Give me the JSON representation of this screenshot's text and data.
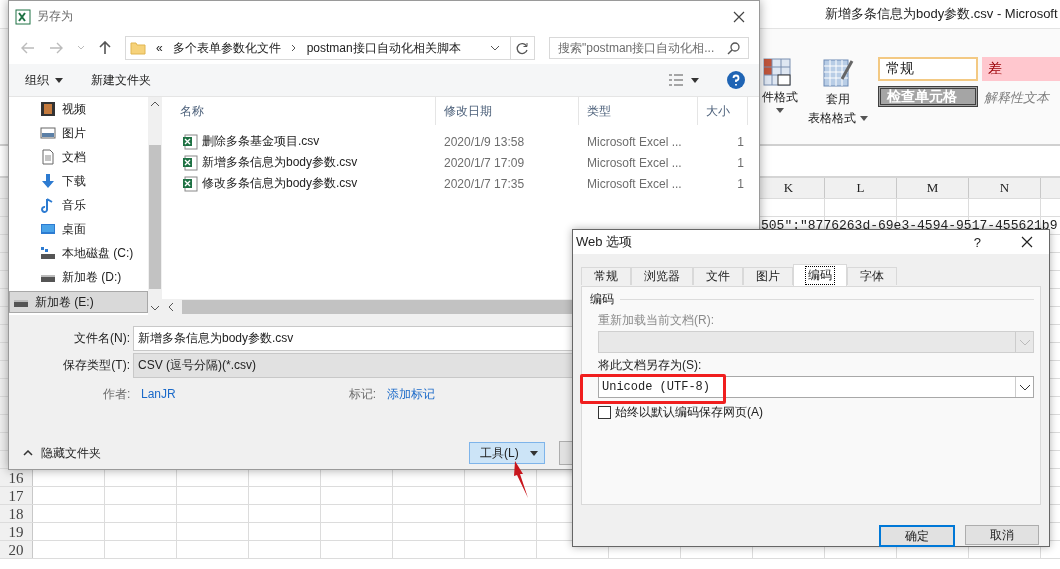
{
  "excel": {
    "title": "新增多条信息为body参数.csv  -  Microsoft",
    "ribbon": {
      "conditional_format": "件格式",
      "table_format_top": "套用",
      "table_format_bottom": "表格格式",
      "styles": [
        {
          "label": "常规",
          "kind": "normal"
        },
        {
          "label": "差",
          "kind": "bad"
        },
        {
          "label": "检查单元格",
          "kind": "check"
        },
        {
          "label": "解释性文本",
          "kind": "explanatory"
        }
      ]
    },
    "columns": [
      "K",
      "L",
      "M",
      "N"
    ],
    "cell_text": "505\":\"8776263d-69e3-4594-9517-455621b9",
    "rows": [
      "16",
      "17",
      "18",
      "19",
      "20"
    ]
  },
  "save_as": {
    "title": "另存为",
    "path": [
      "«",
      "多个表单参数化文件",
      "postman接口自动化相关脚本"
    ],
    "search_placeholder": "搜索\"postman接口自动化相...",
    "organize": "组织",
    "new_folder": "新建文件夹",
    "nav": [
      {
        "label": "视频",
        "kind": "video",
        "selected": false
      },
      {
        "label": "图片",
        "kind": "picture",
        "selected": false
      },
      {
        "label": "文档",
        "kind": "document",
        "selected": false
      },
      {
        "label": "下载",
        "kind": "download",
        "selected": false
      },
      {
        "label": "音乐",
        "kind": "music",
        "selected": false
      },
      {
        "label": "桌面",
        "kind": "desktop",
        "selected": false
      },
      {
        "label": "本地磁盘 (C:)",
        "kind": "system-drive",
        "selected": false
      },
      {
        "label": "新加卷 (D:)",
        "kind": "drive",
        "selected": false
      },
      {
        "label": "新加卷 (E:)",
        "kind": "drive",
        "selected": true
      }
    ],
    "columns": [
      "名称",
      "修改日期",
      "类型",
      "大小"
    ],
    "files": [
      {
        "name": "删除多条基金项目.csv",
        "date": "2020/1/9 13:58",
        "type": "Microsoft Excel ...",
        "size": "1"
      },
      {
        "name": "新增多条信息为body参数.csv",
        "date": "2020/1/7 17:09",
        "type": "Microsoft Excel ...",
        "size": "1"
      },
      {
        "name": "修改多条信息为body参数.csv",
        "date": "2020/1/7 17:35",
        "type": "Microsoft Excel ...",
        "size": "1"
      }
    ],
    "filename_label": "文件名(N):",
    "filename": "新增多条信息为body参数.csv",
    "type_label": "保存类型(T):",
    "type_value": "CSV (逗号分隔)(*.csv)",
    "author_label": "作者:",
    "author": "LanJR",
    "tags_label": "标记:",
    "tags": "添加标记",
    "hide_folders": "隐藏文件夹",
    "tools": "工具(L)"
  },
  "web_options": {
    "title": "Web 选项",
    "help": "?",
    "tabs": [
      {
        "label": "常规",
        "selected": false
      },
      {
        "label": "浏览器",
        "selected": false
      },
      {
        "label": "文件",
        "selected": false
      },
      {
        "label": "图片",
        "selected": false
      },
      {
        "label": "编码",
        "selected": true
      },
      {
        "label": "字体",
        "selected": false
      }
    ],
    "group": "编码",
    "reload_label": "重新加载当前文档(R):",
    "reload_disabled": true,
    "save_label": "将此文档另存为(S):",
    "save_value": "Unicode (UTF-8)",
    "checkbox": {
      "label": "始终以默认编码保存网页(A)",
      "checked": false
    },
    "ok": "确定",
    "cancel": "取消"
  }
}
